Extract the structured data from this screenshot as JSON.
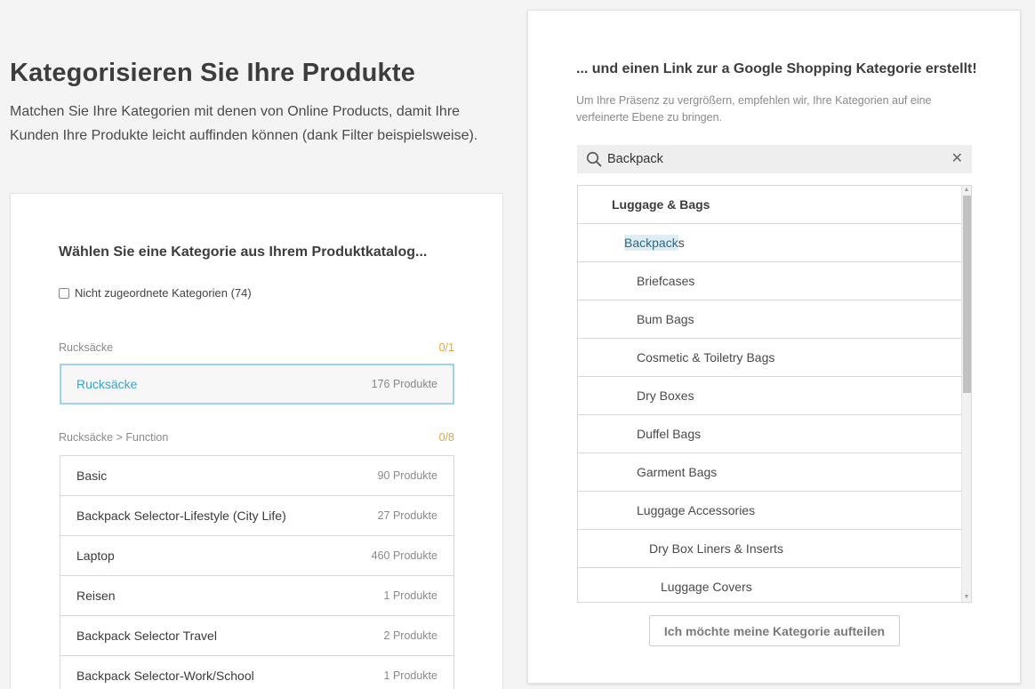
{
  "hero": {
    "title": "Kategorisieren Sie Ihre Produkte",
    "description": "Matchen Sie Ihre Kategorien mit denen von Online Products, damit Ihre Kunden Ihre Produkte leicht auffinden können (dank Filter beispielsweise)."
  },
  "left": {
    "heading": "Wählen Sie eine Kategorie aus Ihrem Produktkatalog...",
    "filter_label": "Nicht zugeordnete Kategorien (74)",
    "group1": {
      "label": "Rucksäcke",
      "count": "0/1"
    },
    "selected": {
      "name": "Rucksäcke",
      "count": "176 Produkte"
    },
    "group2": {
      "label": "Rucksäcke > Function",
      "count": "0/8"
    },
    "items": [
      {
        "name": "Basic",
        "count": "90 Produkte"
      },
      {
        "name": "Backpack Selector-Lifestyle (City Life)",
        "count": "27 Produkte"
      },
      {
        "name": "Laptop",
        "count": "460 Produkte"
      },
      {
        "name": "Reisen",
        "count": "1 Produkte"
      },
      {
        "name": "Backpack Selector Travel",
        "count": "2 Produkte"
      },
      {
        "name": "Backpack Selector-Work/School",
        "count": "1 Produkte"
      }
    ]
  },
  "right": {
    "heading": "... und einen Link zur a Google Shopping Kategorie erstellt!",
    "description": "Um Ihre Präsenz zu vergrößern, empfehlen wir, Ihre Kategorien auf eine verfeinerte Ebene zu bringen.",
    "search_value": "Backpack",
    "tree": [
      "Luggage & Bags",
      "Backpacks",
      "Briefcases",
      "Bum Bags",
      "Cosmetic & Toiletry Bags",
      "Dry Boxes",
      "Duffel Bags",
      "Garment Bags",
      "Luggage Accessories",
      "Dry Box Liners & Inserts",
      "Luggage Covers"
    ],
    "highlight_prefix": "Backpack",
    "highlight_suffix": "s",
    "split_button": "Ich möchte meine Kategorie aufteilen"
  },
  "colors": {
    "accent": "#35a6cf",
    "count_orange": "#f0a030",
    "highlight_bg": "#dfeef5"
  }
}
